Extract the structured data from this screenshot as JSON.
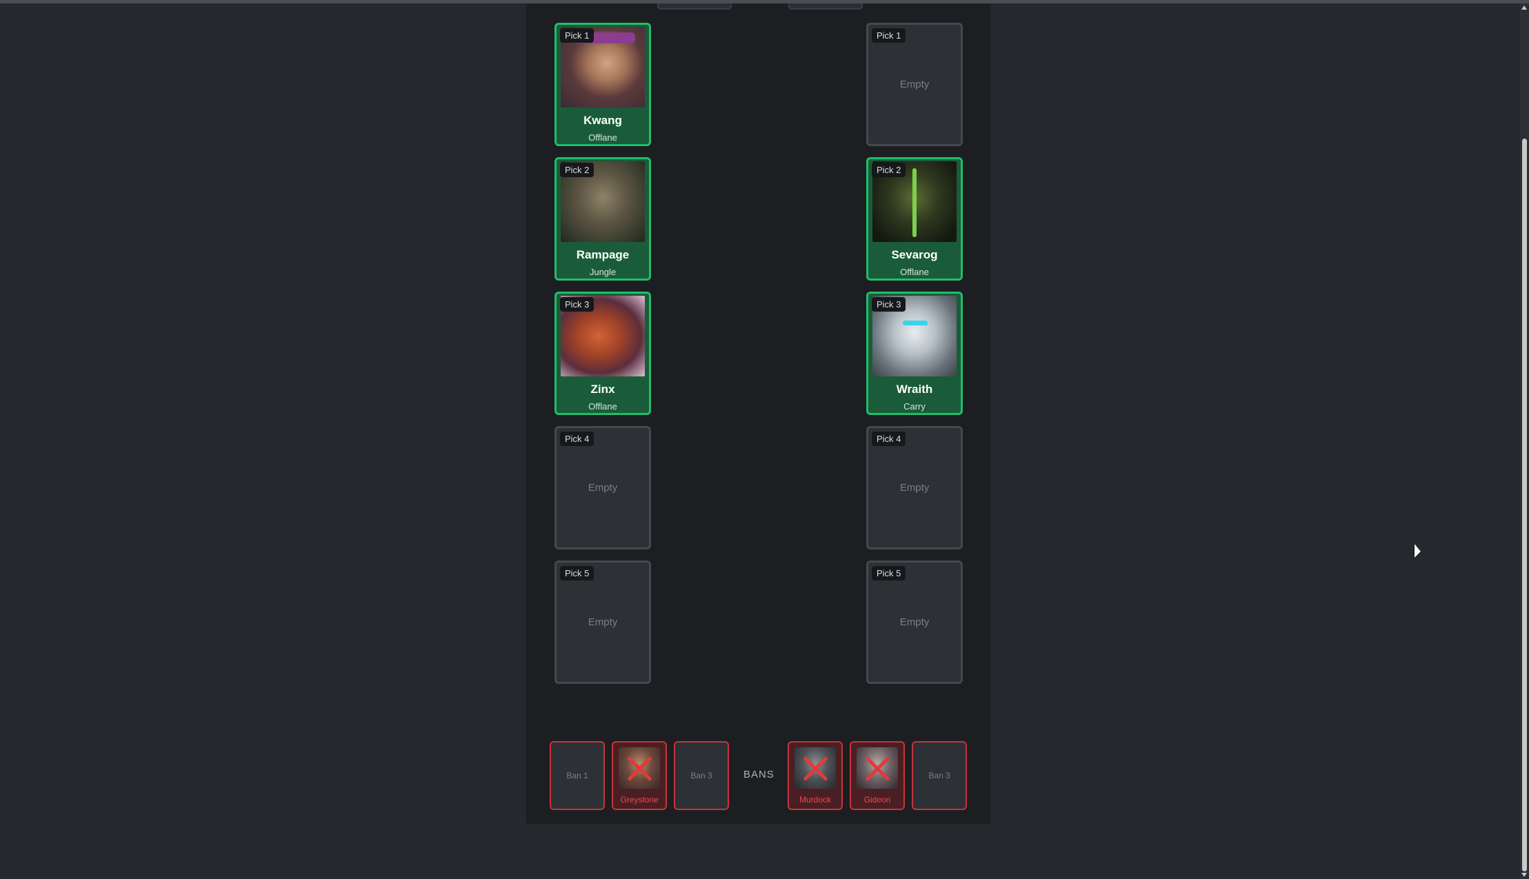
{
  "draft": {
    "team_left": {
      "picks": [
        {
          "label": "Pick 1",
          "hero": "Kwang",
          "role": "Offlane"
        },
        {
          "label": "Pick 2",
          "hero": "Rampage",
          "role": "Jungle"
        },
        {
          "label": "Pick 3",
          "hero": "Zinx",
          "role": "Offlane"
        },
        {
          "label": "Pick 4",
          "empty_text": "Empty"
        },
        {
          "label": "Pick 5",
          "empty_text": "Empty"
        }
      ],
      "bans": [
        {
          "label": "Ban 1"
        },
        {
          "hero": "Greystone"
        },
        {
          "label": "Ban 3"
        }
      ]
    },
    "team_right": {
      "picks": [
        {
          "label": "Pick 1",
          "empty_text": "Empty"
        },
        {
          "label": "Pick 2",
          "hero": "Sevarog",
          "role": "Offlane"
        },
        {
          "label": "Pick 3",
          "hero": "Wraith",
          "role": "Carry"
        },
        {
          "label": "Pick 4",
          "empty_text": "Empty"
        },
        {
          "label": "Pick 5",
          "empty_text": "Empty"
        }
      ],
      "bans": [
        {
          "hero": "Murdock"
        },
        {
          "hero": "Gideon"
        },
        {
          "label": "Ban 3"
        }
      ]
    },
    "bans_label": "BANS"
  },
  "colors": {
    "filled_border": "#1fbf6a",
    "ban_border": "#c7343b",
    "ban_text": "#f0484e"
  }
}
